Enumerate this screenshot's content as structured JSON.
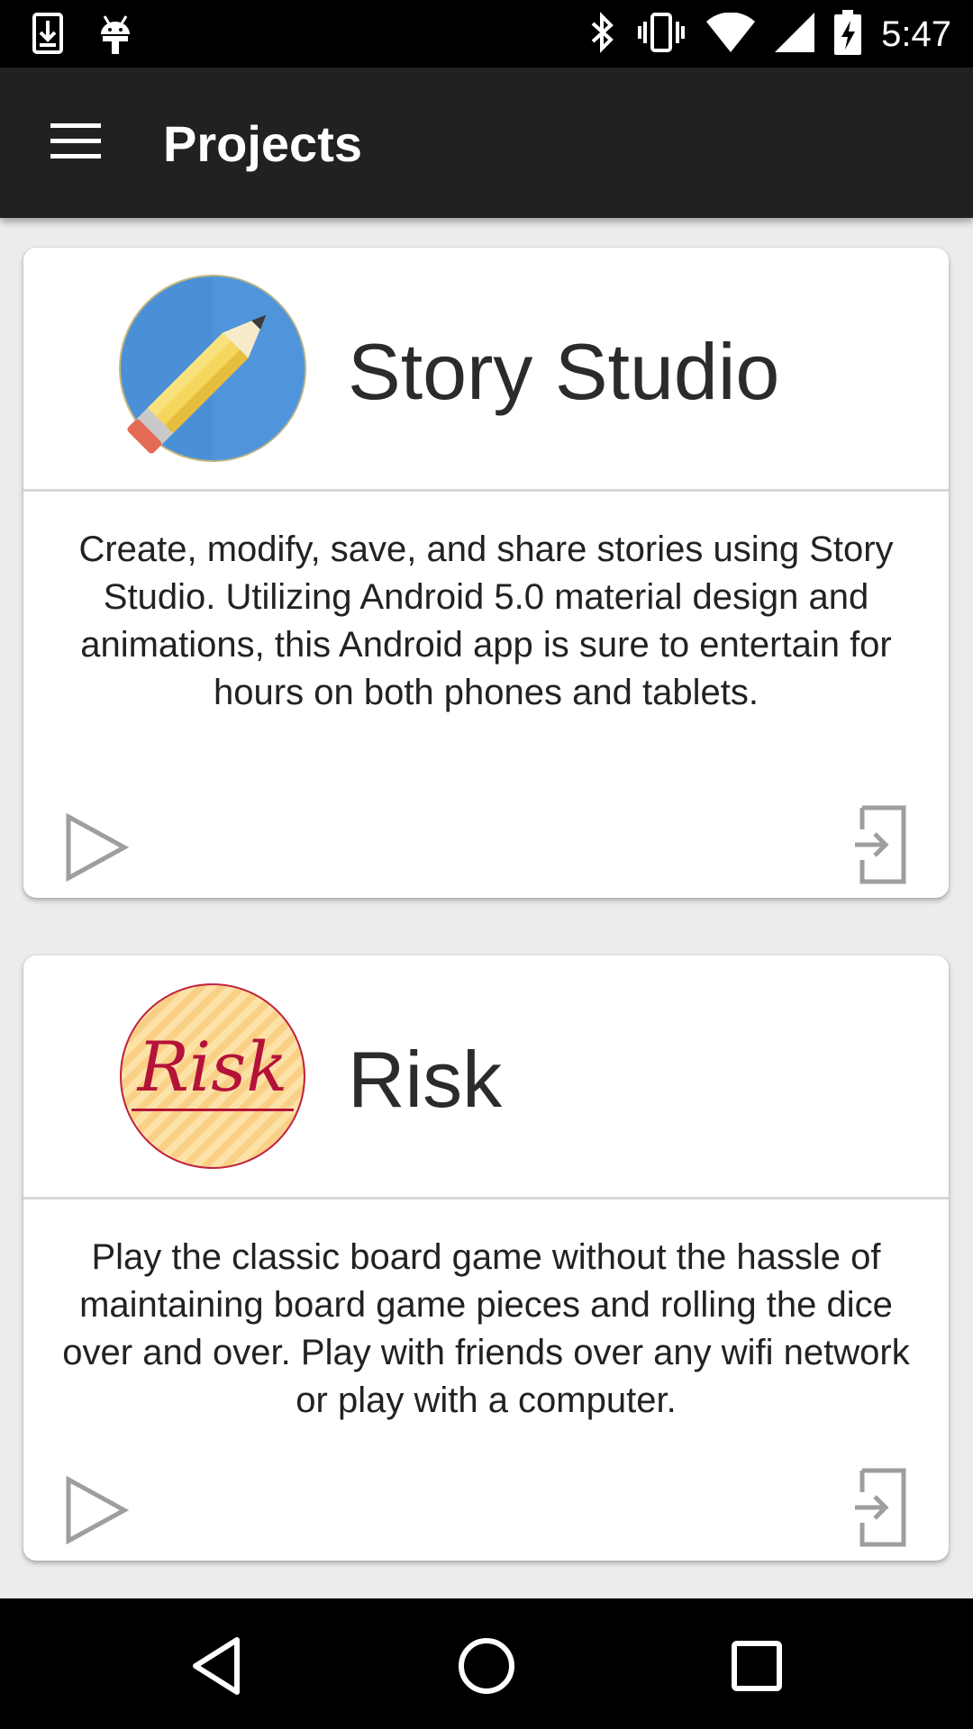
{
  "status_bar": {
    "time": "5:47",
    "left_icons": [
      "download-icon",
      "android-icon"
    ],
    "right_icons": [
      "bluetooth-icon",
      "vibrate-icon",
      "wifi-icon",
      "signal-icon",
      "battery-charging-icon"
    ]
  },
  "app_bar": {
    "title": "Projects",
    "menu_icon": "hamburger-menu-icon"
  },
  "projects": [
    {
      "name": "Story Studio",
      "logo": "pencil-logo",
      "description": "Create, modify, save, and share stories using Story Studio. Utilizing Android 5.0 material design and animations, this Android app is sure to entertain for hours on both phones and tablets.",
      "play_icon": "play-icon",
      "open_icon": "exit-to-app-icon"
    },
    {
      "name": "Risk",
      "logo": "risk-logo",
      "logo_text": "Risk",
      "description": "Play the classic board game without the hassle of maintaining board game pieces and rolling the dice over and over. Play with friends over any wifi network or play with a computer.",
      "play_icon": "play-icon",
      "open_icon": "exit-to-app-icon"
    }
  ],
  "nav_bar": {
    "buttons": [
      "back-icon",
      "home-icon",
      "recents-icon"
    ]
  },
  "colors": {
    "app_bar": "#212121",
    "status_bar": "#000000",
    "background": "#ececec",
    "card": "#ffffff",
    "story_logo_blue": "#4a90d9",
    "risk_logo_red": "#b5123a"
  }
}
